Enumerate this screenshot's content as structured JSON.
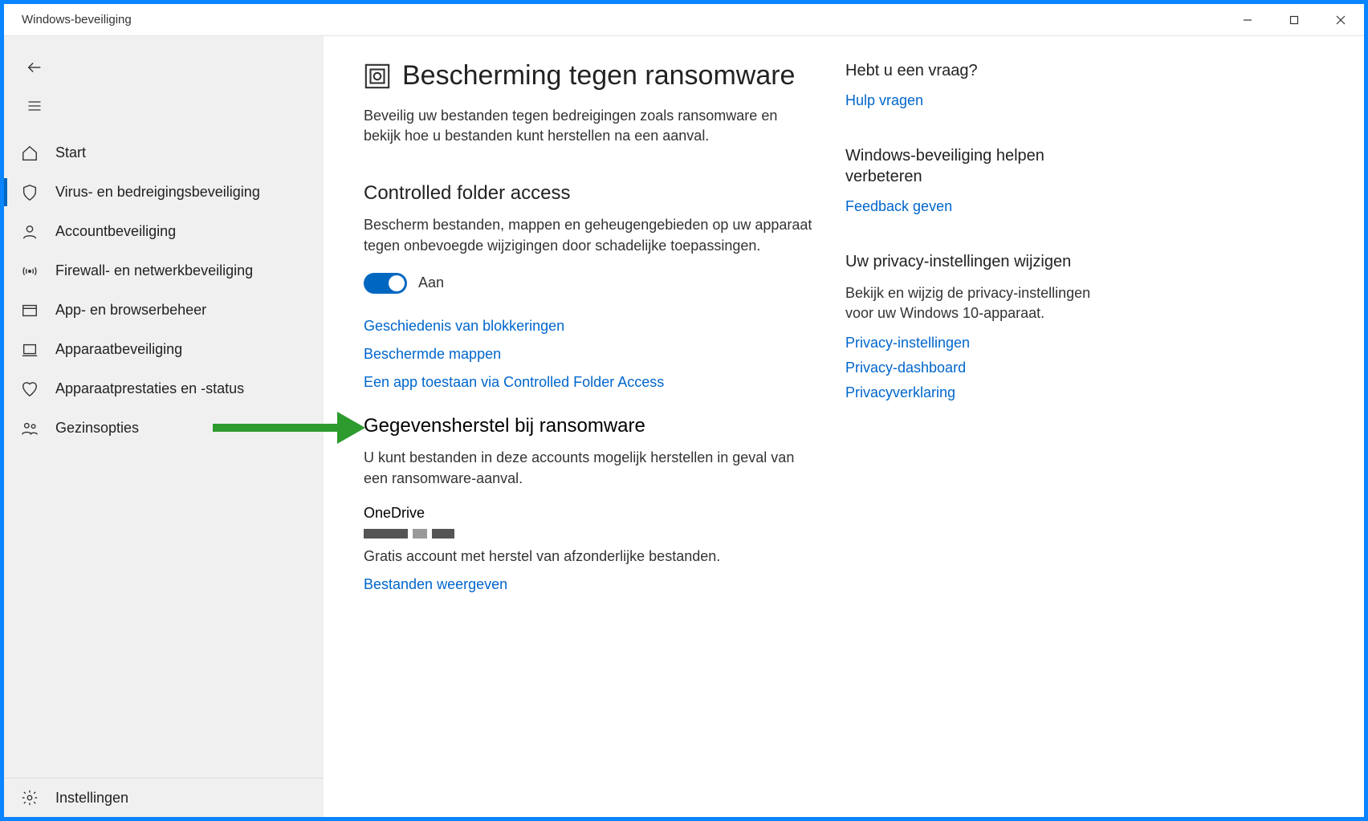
{
  "window": {
    "title": "Windows-beveiliging"
  },
  "nav": {
    "items": [
      {
        "label": "Start"
      },
      {
        "label": "Virus- en bedreigingsbeveiliging"
      },
      {
        "label": "Accountbeveiliging"
      },
      {
        "label": "Firewall- en netwerkbeveiliging"
      },
      {
        "label": "App- en browserbeheer"
      },
      {
        "label": "Apparaatbeveiliging"
      },
      {
        "label": "Apparaatprestaties en -status"
      },
      {
        "label": "Gezinsopties"
      }
    ],
    "settings": "Instellingen"
  },
  "page": {
    "title": "Bescherming tegen ransomware",
    "description": "Beveilig uw bestanden tegen bedreigingen zoals ransomware en bekijk hoe u bestanden kunt herstellen na een aanval."
  },
  "cfa": {
    "title": "Controlled folder access",
    "description": "Bescherm bestanden, mappen en geheugengebieden op uw apparaat tegen onbevoegde wijzigingen door schadelijke toepassingen.",
    "toggle_label": "Aan",
    "links": {
      "history": "Geschiedenis van blokkeringen",
      "protected": "Beschermde mappen",
      "allow": "Een app toestaan via Controlled Folder Access"
    }
  },
  "recovery": {
    "title": "Gegevensherstel bij ransomware",
    "description": "U kunt bestanden in deze accounts mogelijk herstellen in geval van een ransomware-aanval.",
    "onedrive": {
      "title": "OneDrive",
      "subtitle": "Gratis account met herstel van afzonderlijke bestanden.",
      "link": "Bestanden weergeven"
    }
  },
  "aside": {
    "help": {
      "title": "Hebt u een vraag?",
      "link": "Hulp vragen"
    },
    "improve": {
      "title": "Windows-beveiliging helpen verbeteren",
      "link": "Feedback geven"
    },
    "privacy": {
      "title": "Uw privacy-instellingen wijzigen",
      "description": "Bekijk en wijzig de privacy-instellingen voor uw Windows 10-apparaat.",
      "links": {
        "settings": "Privacy-instellingen",
        "dashboard": "Privacy-dashboard",
        "statement": "Privacyverklaring"
      }
    }
  }
}
